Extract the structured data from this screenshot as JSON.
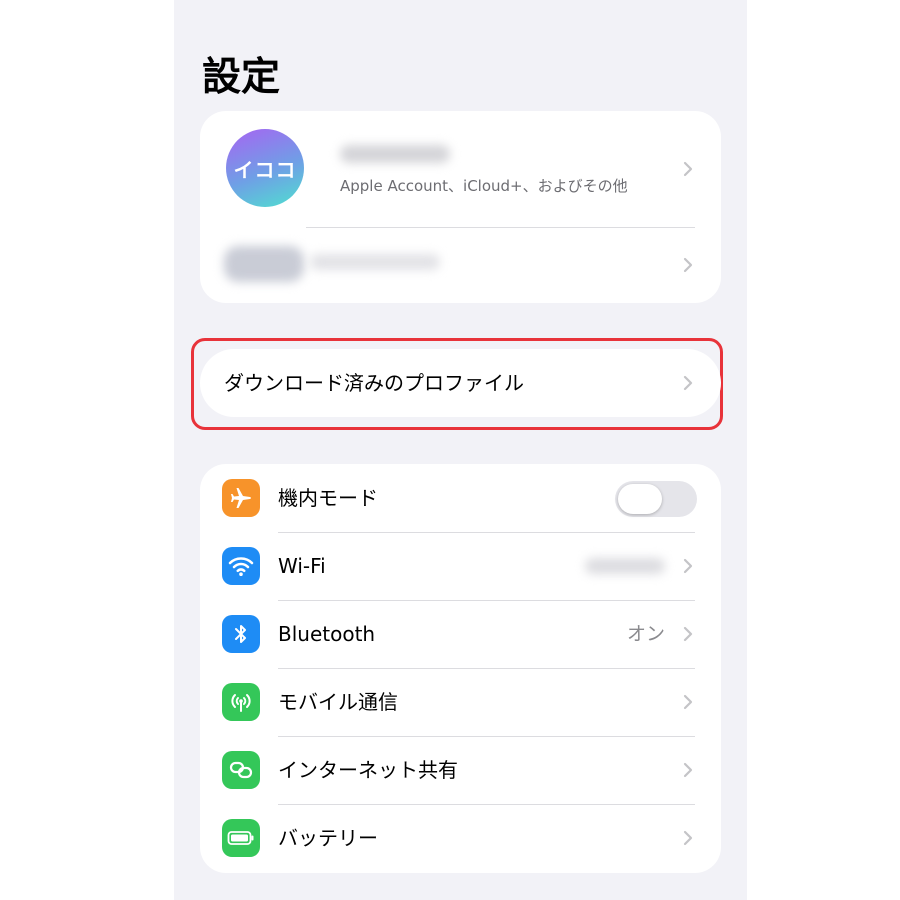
{
  "header": {
    "title": "設定"
  },
  "account": {
    "avatar_initials": "イココ",
    "subtitle": "Apple Account、iCloud+、およびその他"
  },
  "profile": {
    "label": "ダウンロード済みのプロファイル",
    "highlight_color": "#e8333a"
  },
  "settings": {
    "items": [
      {
        "label": "機内モード",
        "icon": "airplane-icon",
        "color": "#f7932a",
        "control": "toggle",
        "on": false
      },
      {
        "label": "Wi-Fi",
        "icon": "wifi-icon",
        "color": "#1e8cf5"
      },
      {
        "label": "Bluetooth",
        "icon": "bluetooth-icon",
        "color": "#1e8cf5",
        "value": "オン"
      },
      {
        "label": "モバイル通信",
        "icon": "antenna-icon",
        "color": "#34c759"
      },
      {
        "label": "インターネット共有",
        "icon": "link-icon",
        "color": "#34c759"
      },
      {
        "label": "バッテリー",
        "icon": "battery-icon",
        "color": "#34c759"
      }
    ]
  }
}
